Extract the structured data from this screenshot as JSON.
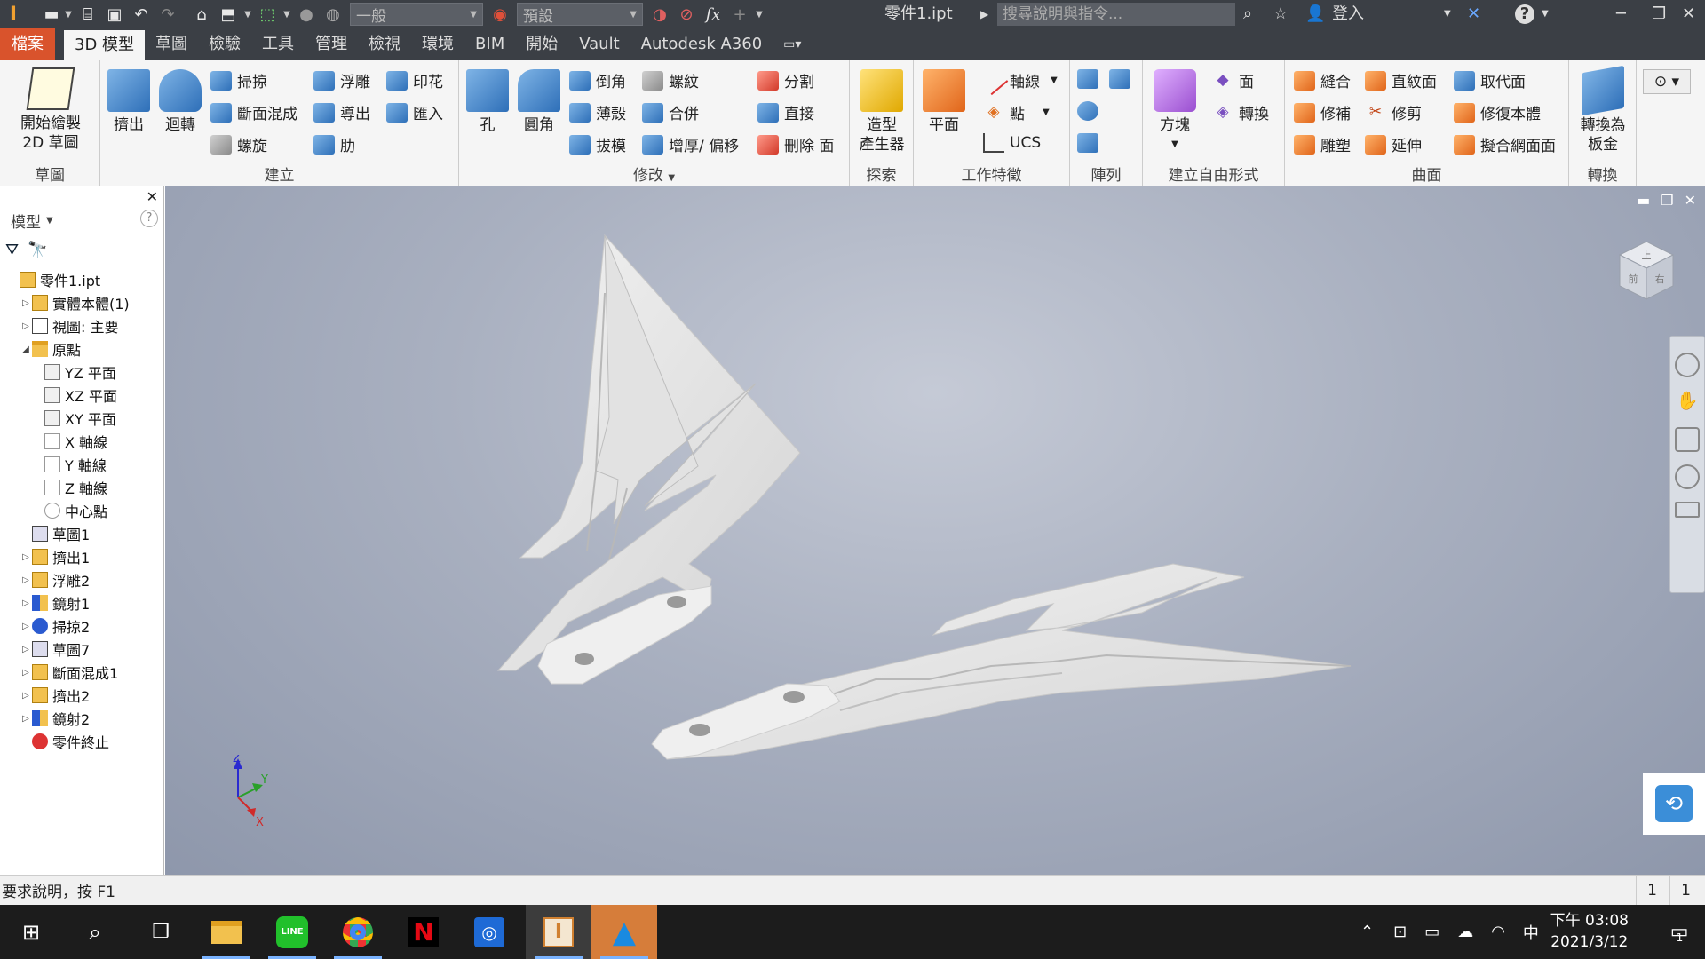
{
  "titlebar": {
    "doc_title": "零件1.ipt",
    "search_placeholder": "搜尋說明與指令...",
    "style_select": "一般",
    "appearance_select": "預設",
    "signin": "登入"
  },
  "tabs": [
    "檔案",
    "3D 模型",
    "草圖",
    "檢驗",
    "工具",
    "管理",
    "檢視",
    "環境",
    "BIM",
    "開始",
    "Vault",
    "Autodesk A360"
  ],
  "ribbon": {
    "sketch": {
      "button": "開始繪製\n2D 草圖",
      "title": "草圖"
    },
    "create": {
      "title": "建立",
      "extrude": "擠出",
      "revolve": "迴轉",
      "sweep": "掃掠",
      "loft": "斷面混成",
      "coil": "螺旋",
      "emboss": "浮雕",
      "derive": "導出",
      "rib": "肋",
      "decal": "印花",
      "import": "匯入"
    },
    "modify": {
      "title": "修改",
      "hole": "孔",
      "fillet": "圓角",
      "chamfer": "倒角",
      "shell": "薄殼",
      "draft": "拔模",
      "thread": "螺紋",
      "combine": "合併",
      "thicken": "增厚/ 偏移",
      "split": "分割",
      "direct": "直接",
      "delete_face": "刪除 面"
    },
    "explore": {
      "title": "探索",
      "shape_generator": "造型\n產生器"
    },
    "work_features": {
      "title": "工作特徵",
      "plane": "平面",
      "axis": "軸線",
      "point": "點",
      "ucs": "UCS"
    },
    "pattern": {
      "title": "陣列"
    },
    "freeform": {
      "title": "建立自由形式",
      "box": "方塊",
      "face": "面",
      "convert": "轉換"
    },
    "surface": {
      "title": "曲面",
      "stitch": "縫合",
      "patch": "修補",
      "sculpt": "雕塑",
      "ruled": "直紋面",
      "trim": "修剪",
      "extend": "延伸",
      "replace": "取代面",
      "repair": "修復本體",
      "fit_mesh": "擬合網面面"
    },
    "convert": {
      "title": "轉換",
      "sheet_metal": "轉換為\n板金"
    }
  },
  "browser": {
    "title": "模型",
    "items": [
      {
        "label": "零件1.ipt",
        "level": 0,
        "icon": "part-icon",
        "expander": ""
      },
      {
        "label": "實體本體(1)",
        "level": 1,
        "icon": "solid-bodies-icon",
        "expander": "▷"
      },
      {
        "label": "視圖: 主要",
        "level": 1,
        "icon": "view-rep-icon",
        "expander": "▷"
      },
      {
        "label": "原點",
        "level": 1,
        "icon": "folder-icon",
        "expander": "◢"
      },
      {
        "label": "YZ 平面",
        "level": 2,
        "icon": "plane-icon",
        "expander": ""
      },
      {
        "label": "XZ 平面",
        "level": 2,
        "icon": "plane-icon",
        "expander": ""
      },
      {
        "label": "XY 平面",
        "level": 2,
        "icon": "plane-icon",
        "expander": ""
      },
      {
        "label": "X 軸線",
        "level": 2,
        "icon": "axis-icon",
        "expander": ""
      },
      {
        "label": "Y 軸線",
        "level": 2,
        "icon": "axis-icon",
        "expander": ""
      },
      {
        "label": "Z 軸線",
        "level": 2,
        "icon": "axis-icon",
        "expander": ""
      },
      {
        "label": "中心點",
        "level": 2,
        "icon": "center-point-icon",
        "expander": ""
      },
      {
        "label": "草圖1",
        "level": 1,
        "icon": "sketch-icon",
        "expander": ""
      },
      {
        "label": "擠出1",
        "level": 1,
        "icon": "extrude-icon",
        "expander": "▷"
      },
      {
        "label": "浮雕2",
        "level": 1,
        "icon": "emboss-icon",
        "expander": "▷"
      },
      {
        "label": "鏡射1",
        "level": 1,
        "icon": "mirror-icon",
        "expander": "▷"
      },
      {
        "label": "掃掠2",
        "level": 1,
        "icon": "sweep-icon",
        "expander": "▷"
      },
      {
        "label": "草圖7",
        "level": 1,
        "icon": "sketch-icon",
        "expander": "▷"
      },
      {
        "label": "斷面混成1",
        "level": 1,
        "icon": "loft-icon",
        "expander": "▷"
      },
      {
        "label": "擠出2",
        "level": 1,
        "icon": "extrude-icon",
        "expander": "▷"
      },
      {
        "label": "鏡射2",
        "level": 1,
        "icon": "mirror-icon",
        "expander": "▷"
      },
      {
        "label": "零件終止",
        "level": 1,
        "icon": "end-of-part-icon",
        "expander": ""
      }
    ]
  },
  "viewcube": {
    "face_top": "上",
    "face_front": "前",
    "face_right": "右"
  },
  "triad": {
    "x": "X",
    "y": "Y",
    "z": "Z"
  },
  "status": {
    "text": "要求說明，按 F1",
    "count1": "1",
    "count2": "1"
  },
  "clock": {
    "time": "下午 03:08",
    "date": "2021/3/12"
  },
  "tray": {
    "ime": "中",
    "notifications": "1"
  },
  "colors": {
    "titlebar": "#3b3f45",
    "file_tab": "#d9532c",
    "ribbon": "#f5f5f5",
    "viewport": "#a9b0c0",
    "model": "#e6e6e6",
    "taskbar": "#1c1c1c"
  }
}
